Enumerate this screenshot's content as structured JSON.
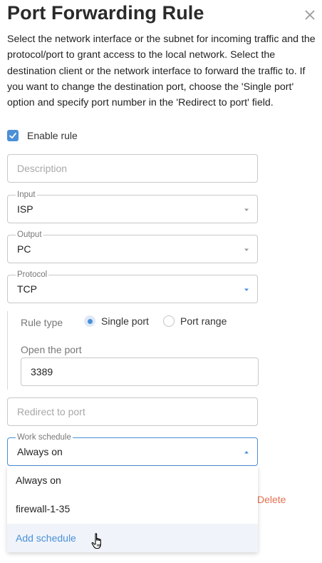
{
  "dialog": {
    "title": "Port Forwarding Rule",
    "description": "Select the network interface or the subnet for incoming traffic and the protocol/port to grant access to the local network. Select the destination client or the network interface to forward the traffic to. If you want to change the destination port, choose the 'Single port' option and specify port number in the 'Redirect to port' field."
  },
  "enable_rule": {
    "label": "Enable rule",
    "checked": true
  },
  "description_field": {
    "placeholder": "Description",
    "value": ""
  },
  "input_select": {
    "legend": "Input",
    "value": "ISP"
  },
  "output_select": {
    "legend": "Output",
    "value": "PC"
  },
  "protocol_select": {
    "legend": "Protocol",
    "value": "TCP"
  },
  "rule_type": {
    "label": "Rule type",
    "options": [
      {
        "label": "Single port",
        "selected": true
      },
      {
        "label": "Port range",
        "selected": false
      }
    ]
  },
  "open_port": {
    "label": "Open the port",
    "value": "3389"
  },
  "redirect_port": {
    "placeholder": "Redirect to port",
    "value": ""
  },
  "work_schedule": {
    "legend": "Work schedule",
    "value": "Always on",
    "options": [
      "Always on",
      "firewall-1-35",
      "Add schedule"
    ]
  },
  "delete_label": "Delete",
  "colors": {
    "accent": "#4a8fd8",
    "danger": "#e0704f",
    "border": "#c8c8c8"
  }
}
